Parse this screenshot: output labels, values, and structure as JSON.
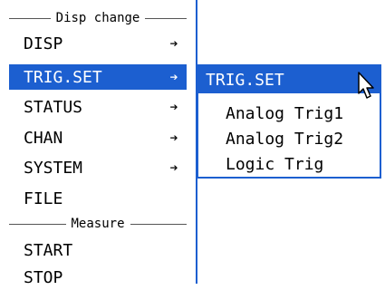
{
  "menu": {
    "disp_header": "Disp change",
    "items": [
      {
        "label": "DISP",
        "arrow": "➔"
      },
      {
        "label": "TRIG.SET",
        "arrow": "➔"
      },
      {
        "label": "STATUS",
        "arrow": "➔"
      },
      {
        "label": "CHAN",
        "arrow": "➔"
      },
      {
        "label": "SYSTEM",
        "arrow": "➔"
      },
      {
        "label": "FILE",
        "arrow": ""
      }
    ],
    "measure_header": "Measure",
    "measure_items": [
      {
        "label": "START"
      },
      {
        "label": "STOP"
      }
    ]
  },
  "submenu": {
    "title": "TRIG.SET",
    "items": [
      {
        "label": "Analog Trig1"
      },
      {
        "label": "Analog Trig2"
      },
      {
        "label": "Logic Trig"
      }
    ]
  },
  "colors": {
    "accent": "#1c5fd0",
    "text": "#000000",
    "background": "#ffffff"
  },
  "icons": {
    "submenu_arrow": "arrow-right-icon",
    "pointer": "mouse-pointer-icon"
  }
}
